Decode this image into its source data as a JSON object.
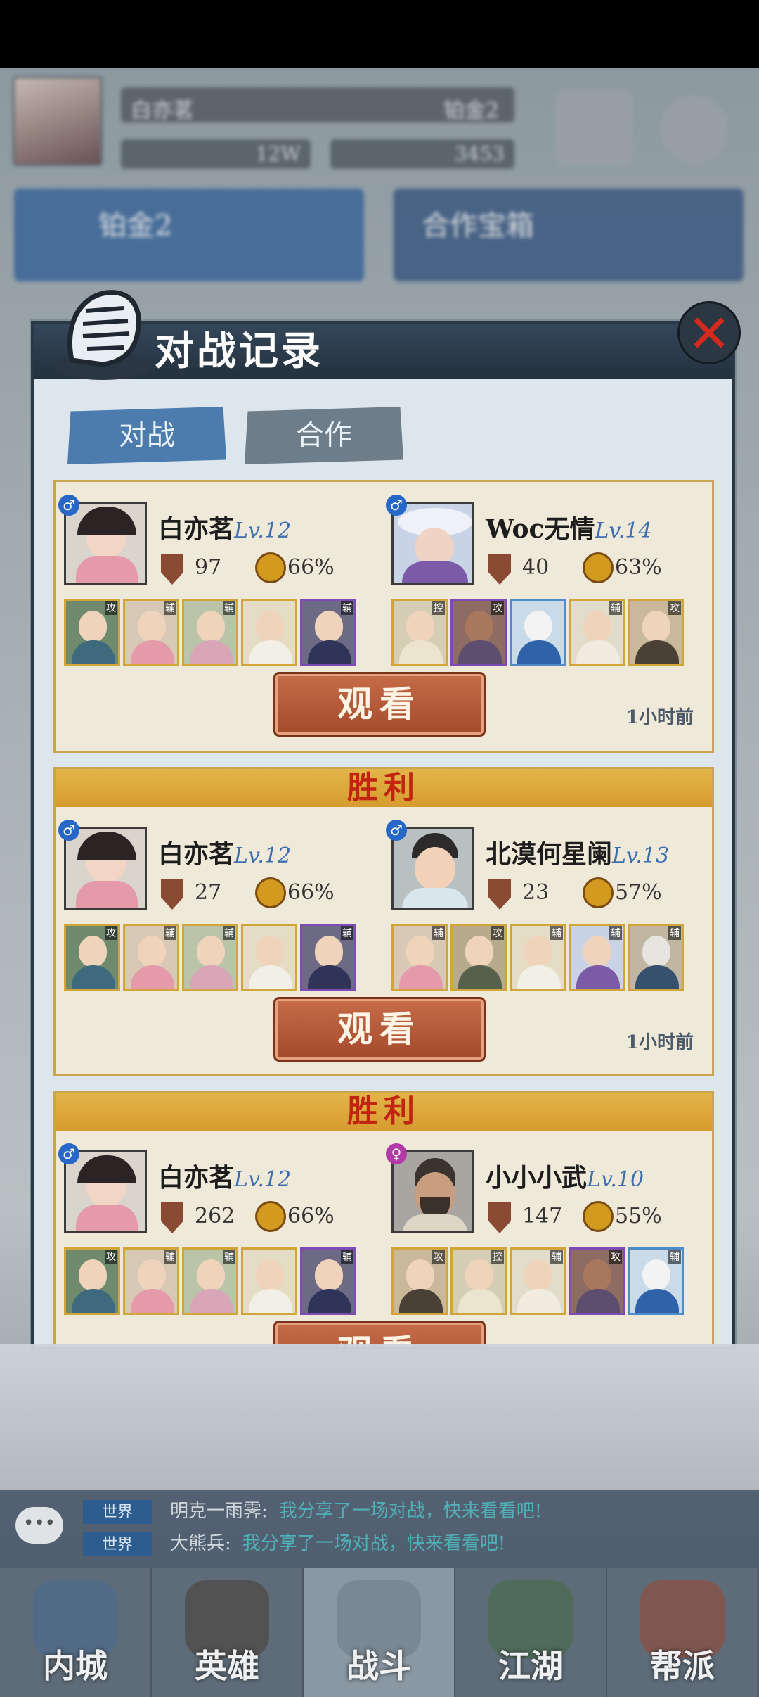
{
  "background": {
    "player_name": "白亦茗",
    "rank_label": "铂金2",
    "resource_1": "12W",
    "resource_2": "3453",
    "card_left_title": "铂金2",
    "card_right_title": "合作宝箱"
  },
  "modal": {
    "title": "对战记录",
    "close_icon": "close-x-icon",
    "tabs": [
      {
        "label": "对战",
        "active": true
      },
      {
        "label": "合作",
        "active": false
      }
    ]
  },
  "records": [
    {
      "result": "",
      "left": {
        "name": "白亦茗",
        "level": "Lv.12",
        "gender": "♂",
        "power": "97",
        "winrate": "66%",
        "heroes": [
          {
            "role": "攻"
          },
          {
            "role": "辅"
          },
          {
            "role": "辅"
          },
          {
            "role": ""
          },
          {
            "role": "辅"
          }
        ]
      },
      "right": {
        "name": "Woc无情",
        "level": "Lv.14",
        "gender": "♂",
        "power": "40",
        "winrate": "63%",
        "heroes": [
          {
            "role": "控"
          },
          {
            "role": "攻"
          },
          {
            "role": ""
          },
          {
            "role": "辅"
          },
          {
            "role": "攻"
          }
        ]
      },
      "button": "观看",
      "time": "1小时前"
    },
    {
      "result": "胜利",
      "left": {
        "name": "白亦茗",
        "level": "Lv.12",
        "gender": "♂",
        "power": "27",
        "winrate": "66%",
        "heroes": [
          {
            "role": "攻"
          },
          {
            "role": "辅"
          },
          {
            "role": "辅"
          },
          {
            "role": ""
          },
          {
            "role": "辅"
          }
        ]
      },
      "right": {
        "name": "北漠何星阑",
        "level": "Lv.13",
        "gender": "♂",
        "power": "23",
        "winrate": "57%",
        "heroes": [
          {
            "role": "辅"
          },
          {
            "role": "攻"
          },
          {
            "role": "辅"
          },
          {
            "role": "辅"
          },
          {
            "role": "辅"
          }
        ]
      },
      "button": "观看",
      "time": "1小时前"
    },
    {
      "result": "胜利",
      "left": {
        "name": "白亦茗",
        "level": "Lv.12",
        "gender": "♂",
        "power": "262",
        "winrate": "66%",
        "heroes": [
          {
            "role": "攻"
          },
          {
            "role": "辅"
          },
          {
            "role": "辅"
          },
          {
            "role": ""
          },
          {
            "role": "辅"
          }
        ]
      },
      "right": {
        "name": "小小小武",
        "level": "Lv.10",
        "gender": "♀",
        "power": "147",
        "winrate": "55%",
        "heroes": [
          {
            "role": "攻"
          },
          {
            "role": "控"
          },
          {
            "role": "辅"
          },
          {
            "role": "攻"
          },
          {
            "role": "辅"
          }
        ]
      },
      "button": "观看",
      "time": ""
    }
  ],
  "chat": [
    {
      "tag": "世界",
      "sender": "明克一雨霁:",
      "message": "我分享了一场对战，快来看看吧!"
    },
    {
      "tag": "世界",
      "sender": "大熊兵:",
      "message": "我分享了一场对战，快来看看吧!"
    }
  ],
  "nav": [
    {
      "label": "内城"
    },
    {
      "label": "英雄"
    },
    {
      "label": "战斗"
    },
    {
      "label": "江湖"
    },
    {
      "label": "帮派"
    }
  ]
}
